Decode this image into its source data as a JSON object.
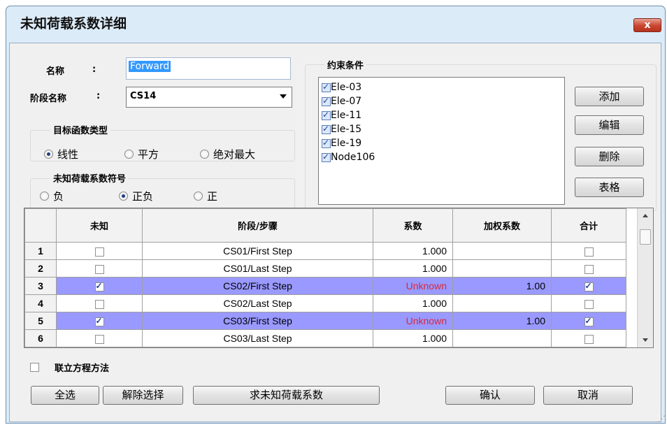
{
  "window": {
    "title": "未知荷载系数详细",
    "close_label": "x"
  },
  "form": {
    "name_label": "名称",
    "name_colon": ":",
    "name_value": "Forward",
    "stage_label": "阶段名称",
    "stage_colon": ":",
    "stage_value": "CS14"
  },
  "objective": {
    "title": "目标函数类型",
    "options": [
      {
        "label": "线性",
        "checked": true
      },
      {
        "label": "平方",
        "checked": false
      },
      {
        "label": "绝对最大",
        "checked": false
      }
    ]
  },
  "sign": {
    "title": "未知荷载系数符号",
    "options": [
      {
        "label": "负",
        "checked": false
      },
      {
        "label": "正负",
        "checked": true
      },
      {
        "label": "正",
        "checked": false
      }
    ]
  },
  "constraints": {
    "title": "约束条件",
    "items": [
      "Ele-03",
      "Ele-07",
      "Ele-11",
      "Ele-15",
      "Ele-19",
      "Node106"
    ],
    "buttons": {
      "add": "添加",
      "edit": "编辑",
      "delete": "删除",
      "table": "表格"
    }
  },
  "grid": {
    "columns": [
      "未知",
      "阶段/步骤",
      "系数",
      "加权系数",
      "合计"
    ],
    "rows": [
      {
        "num": "1",
        "unknown": false,
        "stage": "CS01/First Step",
        "factor": "1.000",
        "weight": "",
        "sum": false,
        "highlight": false
      },
      {
        "num": "2",
        "unknown": false,
        "stage": "CS01/Last Step",
        "factor": "1.000",
        "weight": "",
        "sum": false,
        "highlight": false
      },
      {
        "num": "3",
        "unknown": true,
        "stage": "CS02/First Step",
        "factor": "Unknown",
        "weight": "1.00",
        "sum": true,
        "highlight": true
      },
      {
        "num": "4",
        "unknown": false,
        "stage": "CS02/Last Step",
        "factor": "1.000",
        "weight": "",
        "sum": false,
        "highlight": false
      },
      {
        "num": "5",
        "unknown": true,
        "stage": "CS03/First Step",
        "factor": "Unknown",
        "weight": "1.00",
        "sum": true,
        "highlight": true
      },
      {
        "num": "6",
        "unknown": false,
        "stage": "CS03/Last Step",
        "factor": "1.000",
        "weight": "",
        "sum": false,
        "highlight": false
      }
    ]
  },
  "simultaneous": {
    "label": "联立方程方法",
    "checked": false
  },
  "footer": {
    "select_all": "全选",
    "deselect": "解除选择",
    "solve": "求未知荷载系数",
    "ok": "确认",
    "cancel": "取消"
  },
  "colors": {
    "highlight_row": "#9999ff",
    "unknown_text": "#d62a3f",
    "title_bar": "#dcebf8"
  }
}
